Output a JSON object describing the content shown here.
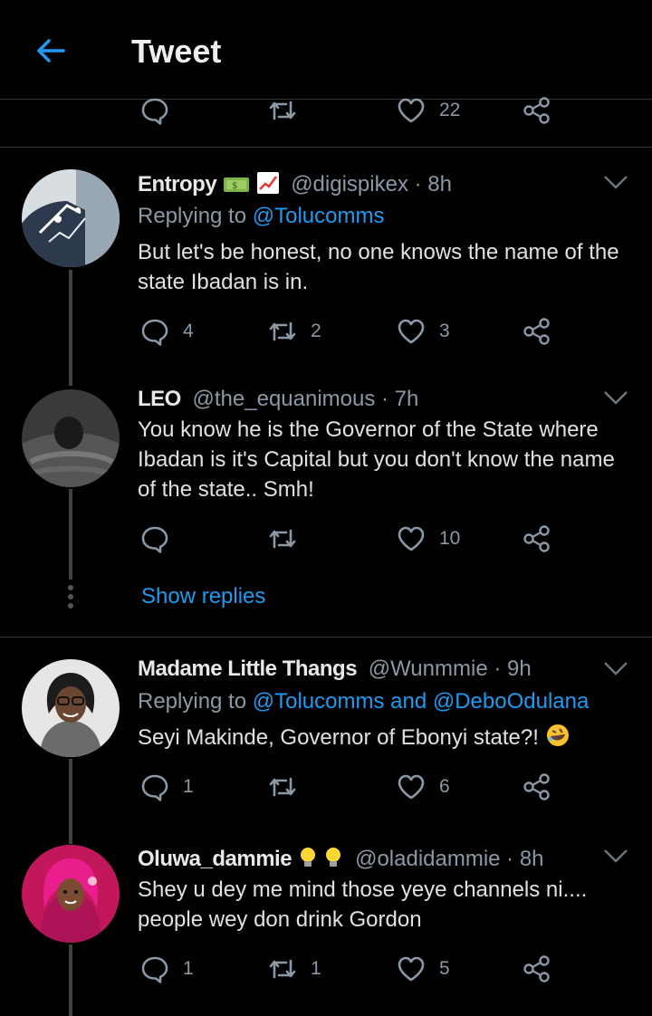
{
  "header": {
    "title": "Tweet"
  },
  "top_actions": {
    "reply_count": "",
    "retweet_count": "",
    "like_count": "22"
  },
  "tweets": [
    {
      "name": "Entropy",
      "handle": "@digispikex · 8h",
      "replying_prefix": "Replying to ",
      "replying_to": "@Tolucomms",
      "text": "But let's be honest, no one knows the name of the state Ibadan is in.",
      "reply_count": "4",
      "retweet_count": "2",
      "like_count": "3"
    },
    {
      "name": "LEO",
      "handle": "@the_equanimous · 7h",
      "text": "You know he is the Governor of the State where Ibadan is it's Capital but you don't know the name of the state.. Smh!",
      "reply_count": "",
      "retweet_count": "",
      "like_count": "10"
    },
    {
      "name": "Madame Little Thangs",
      "handle": "@Wunmmie · 9h",
      "replying_prefix": "Replying to ",
      "replying_to": "@Tolucomms and @DeboOdulana",
      "text": "Seyi Makinde, Governor of Ebonyi state?!",
      "reply_count": "1",
      "retweet_count": "",
      "like_count": "6"
    },
    {
      "name": "Oluwa_dammie",
      "handle": "@oladidammie · 8h",
      "text": "Shey u dey me mind those yeye channels ni.... people wey don drink Gordon",
      "reply_count": "1",
      "retweet_count": "1",
      "like_count": "5"
    }
  ],
  "show_replies": "Show replies",
  "colors": {
    "accent": "#1d9bf0",
    "background": "#000000",
    "muted": "#8b98a5"
  }
}
